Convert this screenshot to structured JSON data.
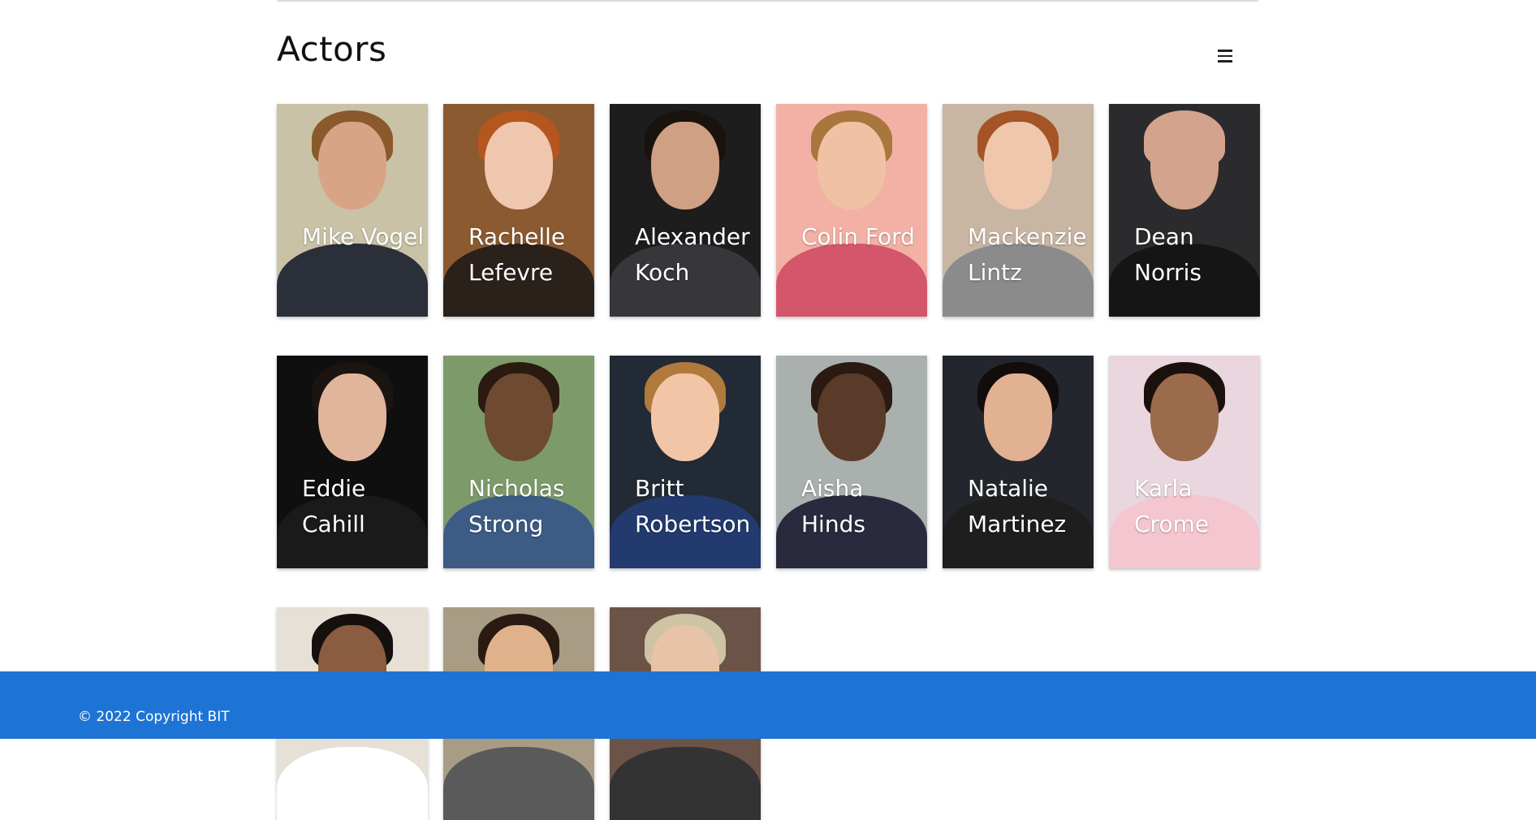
{
  "page": {
    "title": "Actors"
  },
  "header": {
    "menu_icon": "hamburger-menu-icon"
  },
  "actors": [
    {
      "name": "Mike Vogel",
      "bg": "#c9c2a6",
      "skin": "#d7a585",
      "hair": "#8a5a2c",
      "shirt": "#2b2f3a"
    },
    {
      "name": "Rachelle Lefevre",
      "bg": "#8b5a31",
      "skin": "#efc6ae",
      "hair": "#b5561f",
      "shirt": "#2b211b"
    },
    {
      "name": "Alexander Koch",
      "bg": "#1d1d1d",
      "skin": "#cfa084",
      "hair": "#1a120d",
      "shirt": "#37363a"
    },
    {
      "name": "Colin Ford",
      "bg": "#f3b1a5",
      "skin": "#f0c2a3",
      "hair": "#a9773e",
      "shirt": "#d4566a"
    },
    {
      "name": "Mackenzie Lintz",
      "bg": "#c8b6a3",
      "skin": "#efc7ad",
      "hair": "#a55425",
      "shirt": "#8b8b8b"
    },
    {
      "name": "Dean Norris",
      "bg": "#2b2b2d",
      "skin": "#d3a38d",
      "hair": "#d3a38d",
      "shirt": "#151515"
    },
    {
      "name": "Eddie Cahill",
      "bg": "#0f0f0f",
      "skin": "#e0b59b",
      "hair": "#1c1410",
      "shirt": "#1a1a1a"
    },
    {
      "name": "Nicholas Strong",
      "bg": "#7d9b6a",
      "skin": "#6e4a32",
      "hair": "#2a1a10",
      "shirt": "#3c5c86"
    },
    {
      "name": "Britt Robertson",
      "bg": "#222a35",
      "skin": "#f2c5a6",
      "hair": "#b07a3c",
      "shirt": "#223a6e"
    },
    {
      "name": "Aisha Hinds",
      "bg": "#a9b0ad",
      "skin": "#5a3a28",
      "hair": "#2a1a12",
      "shirt": "#2a2a3f"
    },
    {
      "name": "Natalie Martinez",
      "bg": "#24262d",
      "skin": "#e2b192",
      "hair": "#120d0b",
      "shirt": "#1e1e1e"
    },
    {
      "name": "Karla Crome",
      "bg": "#ead6df",
      "skin": "#9b6b4c",
      "hair": "#1a110d",
      "shirt": "#f4c6cf"
    },
    {
      "name": "",
      "bg": "#e6e0d7",
      "skin": "#8a5c40",
      "hair": "#15100d",
      "shirt": "#ffffff"
    },
    {
      "name": "",
      "bg": "#a89c84",
      "skin": "#e0b28c",
      "hair": "#2a1a12",
      "shirt": "#5a5a5a"
    },
    {
      "name": "",
      "bg": "#6b5447",
      "skin": "#e7c3a7",
      "hair": "#cfc3a6",
      "shirt": "#333333"
    }
  ],
  "footer": {
    "copyright": "© 2022 Copyright BIT"
  },
  "colors": {
    "footer_bg": "#1e74d4",
    "text_on_photo": "#ffffff"
  }
}
